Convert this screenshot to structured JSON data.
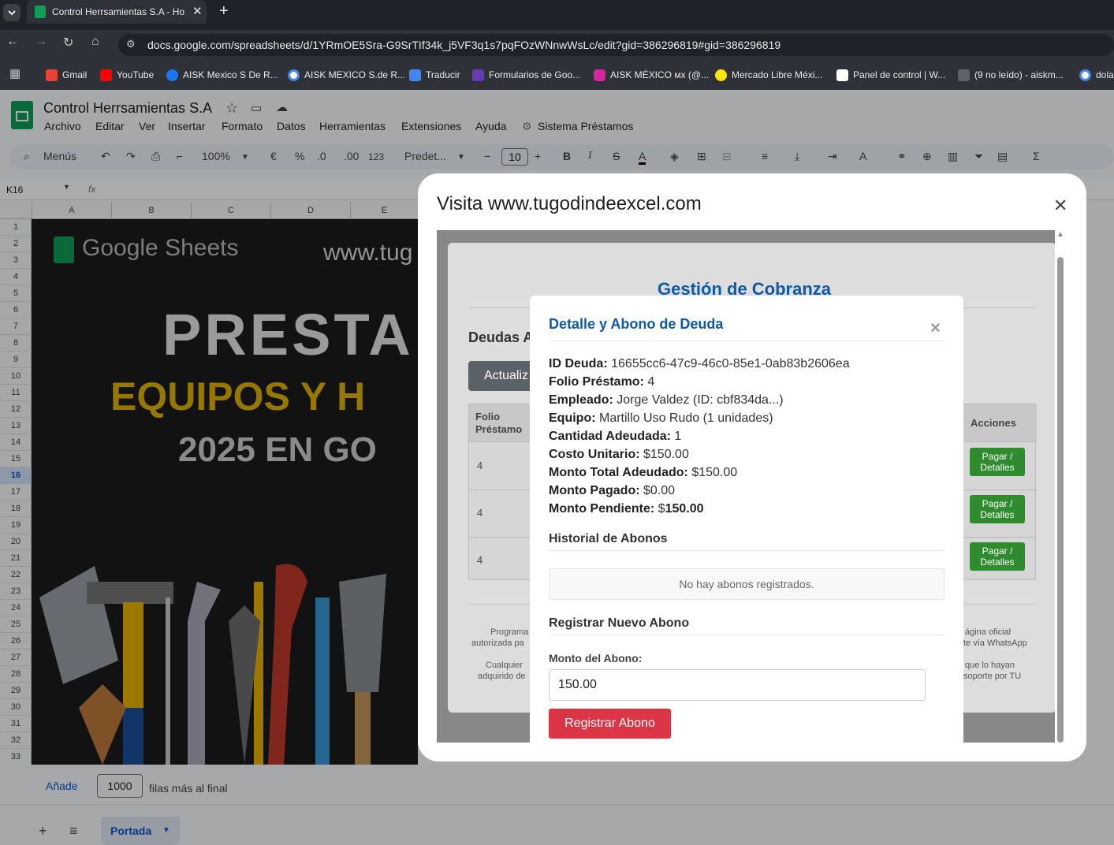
{
  "browser": {
    "tab_title": "Control Herrsamientas S.A - Ho",
    "url": "docs.google.com/spreadsheets/d/1YRmOE5Sra-G9SrTIf34k_j5VF3q1s7pqFOzWNnwWsLc/edit?gid=386296819#gid=386296819",
    "bookmarks": [
      "Gmail",
      "YouTube",
      "AISK Mexico S De R...",
      "AISK MEXICO S.de R...",
      "Traducir",
      "Formularios de Goo...",
      "AISK MÉXICO мх (@...",
      "Mercado Libre Méxi...",
      "Panel de control | W...",
      "(9 no leído) - aiskm...",
      "dola"
    ]
  },
  "sheets": {
    "doc_title": "Control Herrsamientas S.A",
    "menus": [
      "Archivo",
      "Editar",
      "Ver",
      "Insertar",
      "Formato",
      "Datos",
      "Herramientas",
      "Extensiones",
      "Ayuda",
      "Sistema Préstamos"
    ],
    "search_label": "Menús",
    "zoom": "100%",
    "currency": "€",
    "percent": "%",
    "dec_less": ".0",
    "dec_more": ".00",
    "num_format": "123",
    "font": "Predet...",
    "font_size": "10",
    "cell_ref": "K16",
    "fx": "fx",
    "columns": [
      "A",
      "B",
      "C",
      "D",
      "E"
    ],
    "rows": [
      "1",
      "2",
      "3",
      "4",
      "5",
      "6",
      "7",
      "8",
      "9",
      "10",
      "11",
      "12",
      "13",
      "14",
      "15",
      "16",
      "17",
      "18",
      "19",
      "20",
      "21",
      "22",
      "23",
      "24",
      "25",
      "26",
      "27",
      "28",
      "29",
      "30",
      "31",
      "32",
      "33"
    ],
    "banner": {
      "brand": "Google Sheets",
      "site": "www.tug",
      "line1": "PRESTA",
      "line2": "EQUIPOS Y H",
      "line3": "2025 EN GO"
    },
    "add_label": "Añade",
    "add_rows": "1000",
    "add_suffix": "filas más al final",
    "sheet_tab": "Portada"
  },
  "dialog": {
    "title": "Visita www.tugodindeexcel.com",
    "app": {
      "heading": "Gestión de Cobranza",
      "section": "Deudas A",
      "refresh_button": "Actualiz",
      "table_headers": {
        "folio": "Folio Préstamo",
        "actions": "Acciones"
      },
      "rows": [
        {
          "folio": "4",
          "action": "Pagar / Detalles"
        },
        {
          "folio": "4",
          "action": "Pagar / Detalles"
        },
        {
          "folio": "4",
          "action": "Pagar / Detalles"
        }
      ],
      "footer_left": [
        "Programa",
        "autorizada pa",
        "Cualquier",
        "adquirido de"
      ],
      "footer_right": [
        "ágina oficial",
        "te vía WhatsApp",
        "que lo hayan",
        "soporte por TU"
      ]
    },
    "modal": {
      "title": "Detalle y Abono de Deuda",
      "fields": [
        {
          "label": "ID Deuda:",
          "value": "16655cc6-47c9-46c0-85e1-0ab83b2606ea"
        },
        {
          "label": "Folio Préstamo:",
          "value": "4"
        },
        {
          "label": "Empleado:",
          "value": "Jorge Valdez (ID: cbf834da...)"
        },
        {
          "label": "Equipo:",
          "value": "Martillo Uso Rudo (1 unidades)"
        },
        {
          "label": "Cantidad Adeudada:",
          "value": "1"
        },
        {
          "label": "Costo Unitario:",
          "value": "$150.00"
        },
        {
          "label": "Monto Total Adeudado:",
          "value": "$150.00"
        },
        {
          "label": "Monto Pagado:",
          "value": "$0.00"
        },
        {
          "label": "Monto Pendiente:",
          "value": "$",
          "value_bold": "150.00"
        }
      ],
      "history_heading": "Historial de Abonos",
      "history_empty": "No hay abonos registrados.",
      "register_heading": "Registrar Nuevo Abono",
      "amount_label": "Monto del Abono:",
      "amount_value": "150.00",
      "submit": "Registrar Abono"
    }
  },
  "colors": {
    "green_button": "#2e8b2e",
    "red_button": "#dc3545",
    "heading_blue": "#0d5aa7"
  }
}
